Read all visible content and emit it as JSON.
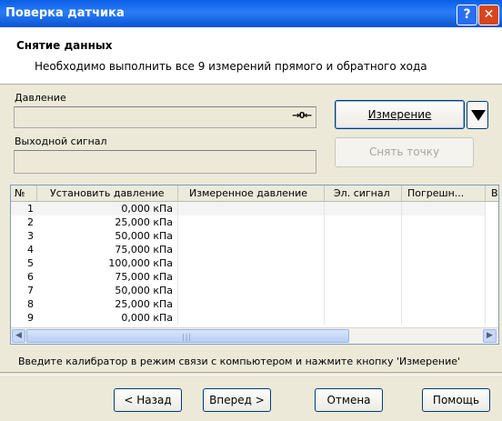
{
  "window": {
    "title": "Поверка датчика",
    "help_label": "?",
    "close_label": "✕"
  },
  "header": {
    "title": "Снятие данных",
    "subtitle": "Необходимо выполнить все 9 измерений прямого и обратного хода"
  },
  "pressure": {
    "label": "Давление",
    "value": "",
    "icon": "→0←"
  },
  "output": {
    "label": "Выходной сигнал",
    "value": ""
  },
  "buttons": {
    "measure": "Измерение",
    "take_point": "Снять точку",
    "back": "< Назад",
    "next": "Вперед >",
    "cancel": "Отмена",
    "help": "Помощь"
  },
  "table": {
    "columns": [
      "№",
      "Установить давление",
      "Измеренное давление",
      "Эл. сигнал",
      "Погрешн...",
      "В"
    ],
    "rows": [
      {
        "n": "1",
        "set": "0,000 кПа"
      },
      {
        "n": "2",
        "set": "25,000 кПа"
      },
      {
        "n": "3",
        "set": "50,000 кПа"
      },
      {
        "n": "4",
        "set": "75,000 кПа"
      },
      {
        "n": "5",
        "set": "100,000 кПа"
      },
      {
        "n": "6",
        "set": "75,000 кПа"
      },
      {
        "n": "7",
        "set": "50,000 кПа"
      },
      {
        "n": "8",
        "set": "25,000 кПа"
      },
      {
        "n": "9",
        "set": "0,000 кПа"
      }
    ]
  },
  "status": "Введите калибратор в режим связи с компьютером и нажмите кнопку 'Измерение'"
}
